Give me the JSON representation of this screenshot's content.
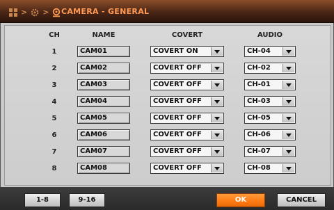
{
  "title": "CAMERA - GENERAL",
  "breadcrumb_icons": [
    "grid-icon",
    "gear-icon",
    "camera-icon"
  ],
  "colors": {
    "accent": "#ff8a2a",
    "title_text": "#ff9a55"
  },
  "columns": {
    "ch": "CH",
    "name": "NAME",
    "covert": "COVERT",
    "audio": "AUDIO"
  },
  "rows": [
    {
      "ch": "1",
      "name": "CAM01",
      "covert": "COVERT ON",
      "audio": "CH-04"
    },
    {
      "ch": "2",
      "name": "CAM02",
      "covert": "COVERT OFF",
      "audio": "CH-02"
    },
    {
      "ch": "3",
      "name": "CAM03",
      "covert": "COVERT OFF",
      "audio": "CH-01"
    },
    {
      "ch": "4",
      "name": "CAM04",
      "covert": "COVERT OFF",
      "audio": "CH-03"
    },
    {
      "ch": "5",
      "name": "CAM05",
      "covert": "COVERT OFF",
      "audio": "CH-05"
    },
    {
      "ch": "6",
      "name": "CAM06",
      "covert": "COVERT OFF",
      "audio": "CH-06"
    },
    {
      "ch": "7",
      "name": "CAM07",
      "covert": "COVERT OFF",
      "audio": "CH-07"
    },
    {
      "ch": "8",
      "name": "CAM08",
      "covert": "COVERT OFF",
      "audio": "CH-08"
    }
  ],
  "footer": {
    "page1": "1-8",
    "page2": "9-16",
    "ok": "OK",
    "cancel": "CANCEL"
  }
}
